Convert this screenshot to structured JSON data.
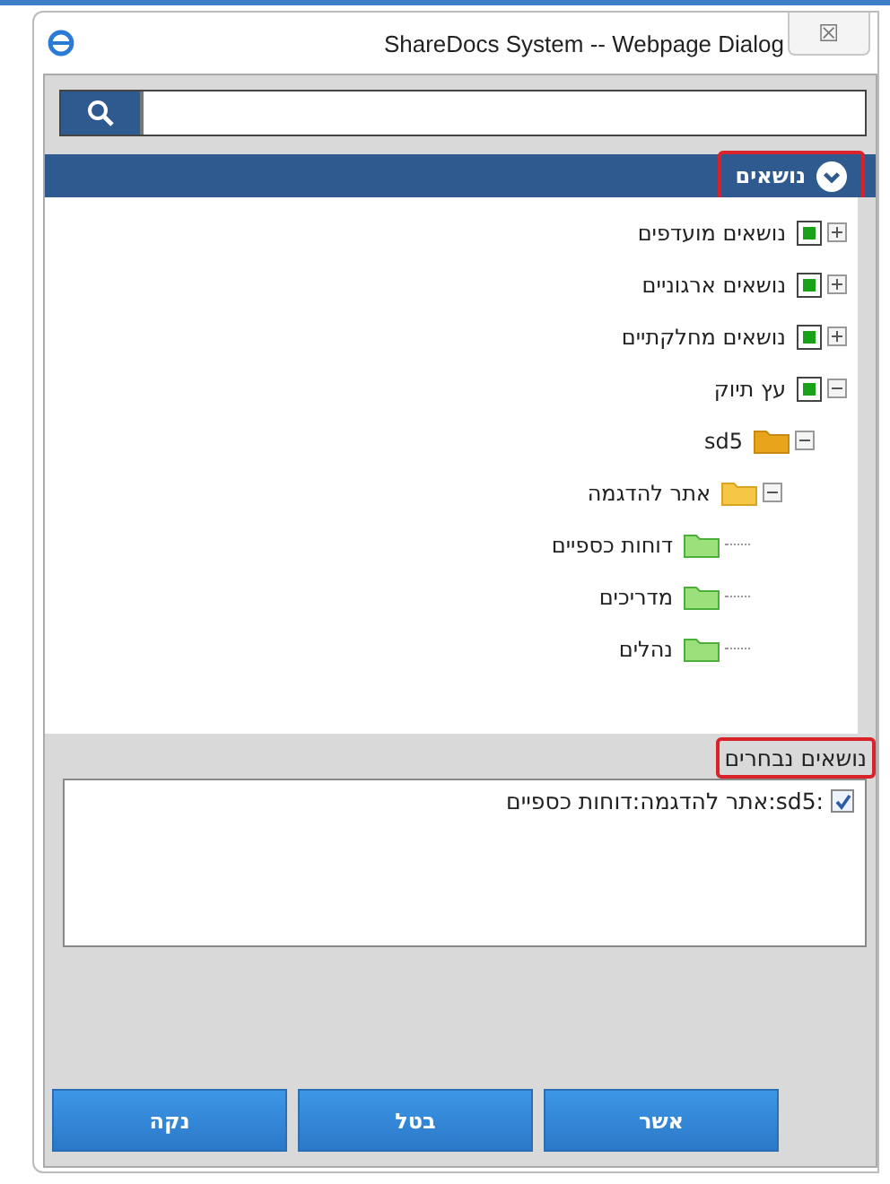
{
  "window": {
    "title": "ShareDocs System -- Webpage Dialog",
    "close": "☒"
  },
  "topics_header": {
    "label": "נושאים",
    "highlighted": true,
    "expanded": true
  },
  "tree": [
    {
      "label": "נושאים מועדפים",
      "kind": "topic",
      "expanded": false
    },
    {
      "label": "נושאים ארגוניים",
      "kind": "topic",
      "expanded": false
    },
    {
      "label": "נושאים מחלקתיים",
      "kind": "topic",
      "expanded": false
    },
    {
      "label": "עץ תיוק",
      "kind": "topic",
      "expanded": true,
      "children": [
        {
          "label": "sd5",
          "kind": "library",
          "expanded": true,
          "children": [
            {
              "label": "אתר להדגמה",
              "kind": "site",
              "expanded": true,
              "children": [
                {
                  "label": "דוחות כספיים",
                  "kind": "folder"
                },
                {
                  "label": "מדריכים",
                  "kind": "folder"
                },
                {
                  "label": "נהלים",
                  "kind": "folder"
                }
              ]
            }
          ]
        }
      ]
    }
  ],
  "selected_label": {
    "label": "נושאים נבחרים",
    "highlighted": true
  },
  "selected_topics": [
    {
      "label": ":sd5:אתר להדגמה:דוחות כספיים",
      "checked": true
    }
  ],
  "buttons": [
    {
      "label": "אשר"
    },
    {
      "label": "בטל"
    },
    {
      "label": "נקה"
    }
  ]
}
